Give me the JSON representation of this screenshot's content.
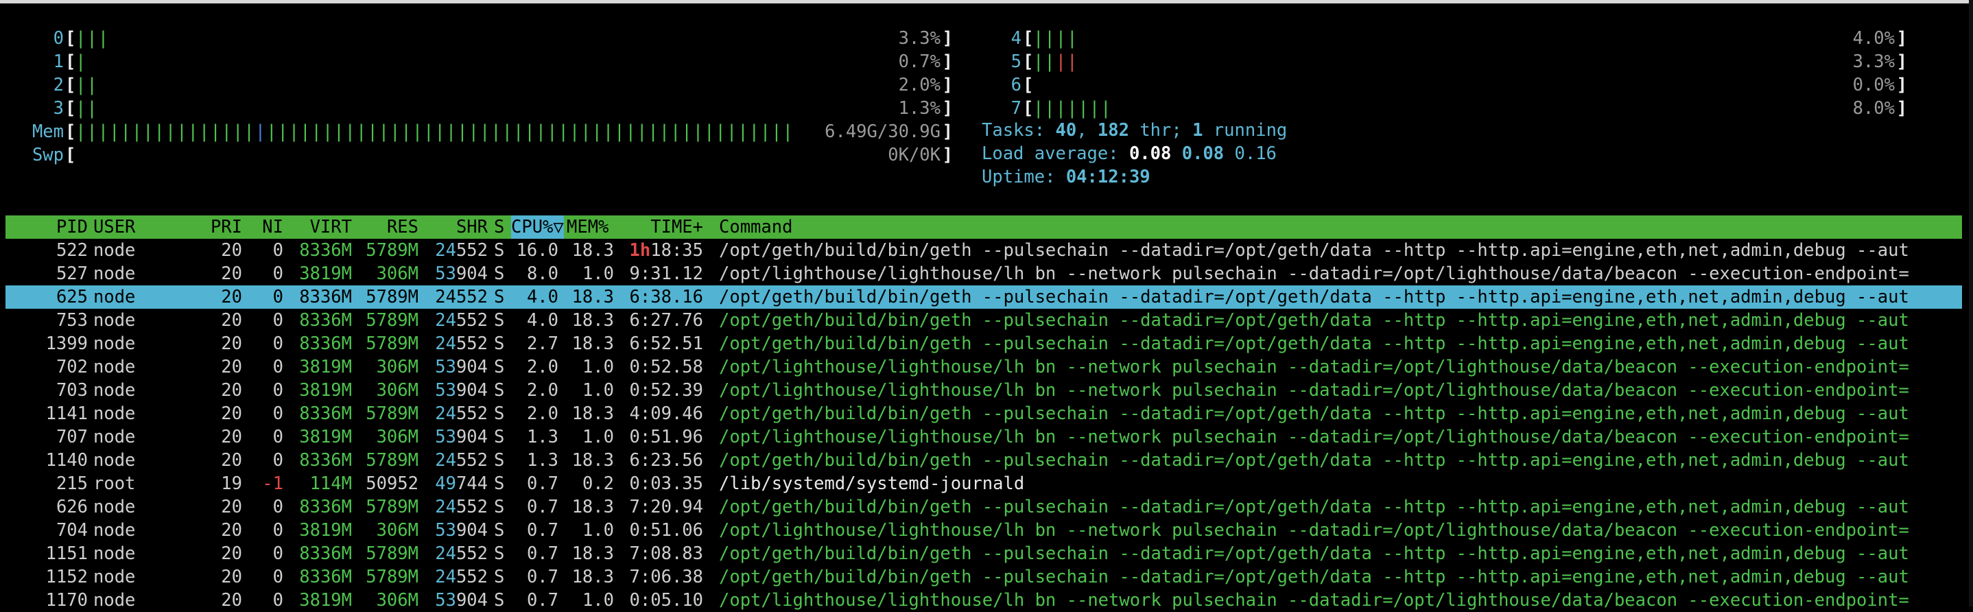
{
  "cpus": [
    {
      "label": "0",
      "bars": "|||",
      "colors": [
        "g",
        "g",
        "g"
      ],
      "value": "3.3%"
    },
    {
      "label": "1",
      "bars": "|",
      "colors": [
        "g"
      ],
      "value": "0.7%"
    },
    {
      "label": "2",
      "bars": "||",
      "colors": [
        "g",
        "g"
      ],
      "value": "2.0%"
    },
    {
      "label": "3",
      "bars": "||",
      "colors": [
        "g",
        "g"
      ],
      "value": "1.3%"
    },
    {
      "label": "4",
      "bars": "||||",
      "colors": [
        "g",
        "g",
        "g",
        "g"
      ],
      "value": "4.0%"
    },
    {
      "label": "5",
      "bars": "||||",
      "colors": [
        "g",
        "g",
        "r",
        "r"
      ],
      "value": "3.3%"
    },
    {
      "label": "6",
      "bars": "",
      "colors": [],
      "value": "0.0%"
    },
    {
      "label": "7",
      "bars": "|||||||",
      "colors": [
        "g",
        "g",
        "g",
        "g",
        "g",
        "g",
        "g"
      ],
      "value": "8.0%"
    }
  ],
  "mem": {
    "label": "Mem",
    "value": "6.49G/30.9G"
  },
  "swp": {
    "label": "Swp",
    "value": "0K/0K"
  },
  "tasks": {
    "prefix": "Tasks: ",
    "count": "40",
    "sep": ", ",
    "threads": "182",
    "thr_label": " thr; ",
    "running": "1",
    "running_label": " running"
  },
  "load": {
    "prefix": "Load average: ",
    "l1": "0.08",
    "l5": "0.08",
    "l15": "0.16"
  },
  "uptime": {
    "prefix": "Uptime: ",
    "value": "04:12:39"
  },
  "columns": {
    "pid": "PID",
    "user": "USER",
    "pri": "PRI",
    "ni": "NI",
    "virt": "VIRT",
    "res": "RES",
    "shr": "SHR",
    "s": "S",
    "cpu": "CPU%▽",
    "mem": "MEM%",
    "time": "TIME+",
    "command": "Command"
  },
  "rows": [
    {
      "pid": "522",
      "user": "node",
      "pri": "20",
      "ni": "0",
      "virt": "8336M",
      "res": "5789M",
      "shr_a": "24",
      "shr_b": "552",
      "s": "S",
      "cpu": "16.0",
      "mem": "18.3",
      "time_h": "1h",
      "time": "18:35",
      "command": "/opt/geth/build/bin/geth --pulsechain --datadir=/opt/geth/data --http --http.api=engine,eth,net,admin,debug --aut",
      "thread": false
    },
    {
      "pid": "527",
      "user": "node",
      "pri": "20",
      "ni": "0",
      "virt": "3819M",
      "res": "306M",
      "shr_a": "53",
      "shr_b": "904",
      "s": "S",
      "cpu": "8.0",
      "mem": "1.0",
      "time_h": "",
      "time": "9:31.12",
      "command": "/opt/lighthouse/lighthouse/lh bn --network pulsechain --datadir=/opt/lighthouse/data/beacon --execution-endpoint=",
      "thread": false
    },
    {
      "pid": "625",
      "user": "node",
      "pri": "20",
      "ni": "0",
      "virt": "8336M",
      "res": "5789M",
      "shr_a": "24",
      "shr_b": "552",
      "s": "S",
      "cpu": "4.0",
      "mem": "18.3",
      "time_h": "",
      "time": "6:38.16",
      "command": "/opt/geth/build/bin/geth --pulsechain --datadir=/opt/geth/data --http --http.api=engine,eth,net,admin,debug --aut",
      "thread": true,
      "selected": true
    },
    {
      "pid": "753",
      "user": "node",
      "pri": "20",
      "ni": "0",
      "virt": "8336M",
      "res": "5789M",
      "shr_a": "24",
      "shr_b": "552",
      "s": "S",
      "cpu": "4.0",
      "mem": "18.3",
      "time_h": "",
      "time": "6:27.76",
      "command": "/opt/geth/build/bin/geth --pulsechain --datadir=/opt/geth/data --http --http.api=engine,eth,net,admin,debug --aut",
      "thread": true
    },
    {
      "pid": "1399",
      "user": "node",
      "pri": "20",
      "ni": "0",
      "virt": "8336M",
      "res": "5789M",
      "shr_a": "24",
      "shr_b": "552",
      "s": "S",
      "cpu": "2.7",
      "mem": "18.3",
      "time_h": "",
      "time": "6:52.51",
      "command": "/opt/geth/build/bin/geth --pulsechain --datadir=/opt/geth/data --http --http.api=engine,eth,net,admin,debug --aut",
      "thread": true
    },
    {
      "pid": "702",
      "user": "node",
      "pri": "20",
      "ni": "0",
      "virt": "3819M",
      "res": "306M",
      "shr_a": "53",
      "shr_b": "904",
      "s": "S",
      "cpu": "2.0",
      "mem": "1.0",
      "time_h": "",
      "time": "0:52.58",
      "command": "/opt/lighthouse/lighthouse/lh bn --network pulsechain --datadir=/opt/lighthouse/data/beacon --execution-endpoint=",
      "thread": true
    },
    {
      "pid": "703",
      "user": "node",
      "pri": "20",
      "ni": "0",
      "virt": "3819M",
      "res": "306M",
      "shr_a": "53",
      "shr_b": "904",
      "s": "S",
      "cpu": "2.0",
      "mem": "1.0",
      "time_h": "",
      "time": "0:52.39",
      "command": "/opt/lighthouse/lighthouse/lh bn --network pulsechain --datadir=/opt/lighthouse/data/beacon --execution-endpoint=",
      "thread": true
    },
    {
      "pid": "1141",
      "user": "node",
      "pri": "20",
      "ni": "0",
      "virt": "8336M",
      "res": "5789M",
      "shr_a": "24",
      "shr_b": "552",
      "s": "S",
      "cpu": "2.0",
      "mem": "18.3",
      "time_h": "",
      "time": "4:09.46",
      "command": "/opt/geth/build/bin/geth --pulsechain --datadir=/opt/geth/data --http --http.api=engine,eth,net,admin,debug --aut",
      "thread": true
    },
    {
      "pid": "707",
      "user": "node",
      "pri": "20",
      "ni": "0",
      "virt": "3819M",
      "res": "306M",
      "shr_a": "53",
      "shr_b": "904",
      "s": "S",
      "cpu": "1.3",
      "mem": "1.0",
      "time_h": "",
      "time": "0:51.96",
      "command": "/opt/lighthouse/lighthouse/lh bn --network pulsechain --datadir=/opt/lighthouse/data/beacon --execution-endpoint=",
      "thread": true
    },
    {
      "pid": "1140",
      "user": "node",
      "pri": "20",
      "ni": "0",
      "virt": "8336M",
      "res": "5789M",
      "shr_a": "24",
      "shr_b": "552",
      "s": "S",
      "cpu": "1.3",
      "mem": "18.3",
      "time_h": "",
      "time": "6:23.56",
      "command": "/opt/geth/build/bin/geth --pulsechain --datadir=/opt/geth/data --http --http.api=engine,eth,net,admin,debug --aut",
      "thread": true
    },
    {
      "pid": "215",
      "user": "root",
      "pri": "19",
      "ni": "-1",
      "virt": "114M",
      "res": "50952",
      "shr_a": "49",
      "shr_b": "744",
      "s": "S",
      "cpu": "0.7",
      "mem": "0.2",
      "time_h": "",
      "time": "0:03.35",
      "command": "/lib/systemd/systemd-journald",
      "thread": false
    },
    {
      "pid": "626",
      "user": "node",
      "pri": "20",
      "ni": "0",
      "virt": "8336M",
      "res": "5789M",
      "shr_a": "24",
      "shr_b": "552",
      "s": "S",
      "cpu": "0.7",
      "mem": "18.3",
      "time_h": "",
      "time": "7:20.94",
      "command": "/opt/geth/build/bin/geth --pulsechain --datadir=/opt/geth/data --http --http.api=engine,eth,net,admin,debug --aut",
      "thread": true
    },
    {
      "pid": "704",
      "user": "node",
      "pri": "20",
      "ni": "0",
      "virt": "3819M",
      "res": "306M",
      "shr_a": "53",
      "shr_b": "904",
      "s": "S",
      "cpu": "0.7",
      "mem": "1.0",
      "time_h": "",
      "time": "0:51.06",
      "command": "/opt/lighthouse/lighthouse/lh bn --network pulsechain --datadir=/opt/lighthouse/data/beacon --execution-endpoint=",
      "thread": true
    },
    {
      "pid": "1151",
      "user": "node",
      "pri": "20",
      "ni": "0",
      "virt": "8336M",
      "res": "5789M",
      "shr_a": "24",
      "shr_b": "552",
      "s": "S",
      "cpu": "0.7",
      "mem": "18.3",
      "time_h": "",
      "time": "7:08.83",
      "command": "/opt/geth/build/bin/geth --pulsechain --datadir=/opt/geth/data --http --http.api=engine,eth,net,admin,debug --aut",
      "thread": true
    },
    {
      "pid": "1152",
      "user": "node",
      "pri": "20",
      "ni": "0",
      "virt": "8336M",
      "res": "5789M",
      "shr_a": "24",
      "shr_b": "552",
      "s": "S",
      "cpu": "0.7",
      "mem": "18.3",
      "time_h": "",
      "time": "7:06.38",
      "command": "/opt/geth/build/bin/geth --pulsechain --datadir=/opt/geth/data --http --http.api=engine,eth,net,admin,debug --aut",
      "thread": true
    },
    {
      "pid": "1170",
      "user": "node",
      "pri": "20",
      "ni": "0",
      "virt": "3819M",
      "res": "306M",
      "shr_a": "53",
      "shr_b": "904",
      "s": "S",
      "cpu": "0.7",
      "mem": "1.0",
      "time_h": "",
      "time": "0:05.10",
      "command": "/opt/lighthouse/lighthouse/lh bn --network pulsechain --datadir=/opt/lighthouse/data/beacon --execution-endpoint=",
      "thread": true
    }
  ]
}
